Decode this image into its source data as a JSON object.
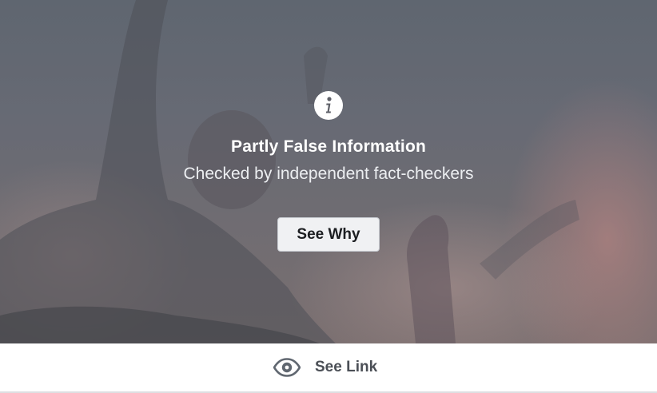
{
  "notice": {
    "title": "Partly False Information",
    "subtitle": "Checked by independent fact-checkers",
    "see_why_label": "See Why",
    "icon": "info-icon"
  },
  "footer": {
    "see_link_label": "See Link",
    "icon": "eye-icon"
  },
  "colors": {
    "overlay": "#676a74",
    "button_bg": "#f0f1f3",
    "button_text": "#1c1e21",
    "footer_text": "#4b4f56"
  }
}
